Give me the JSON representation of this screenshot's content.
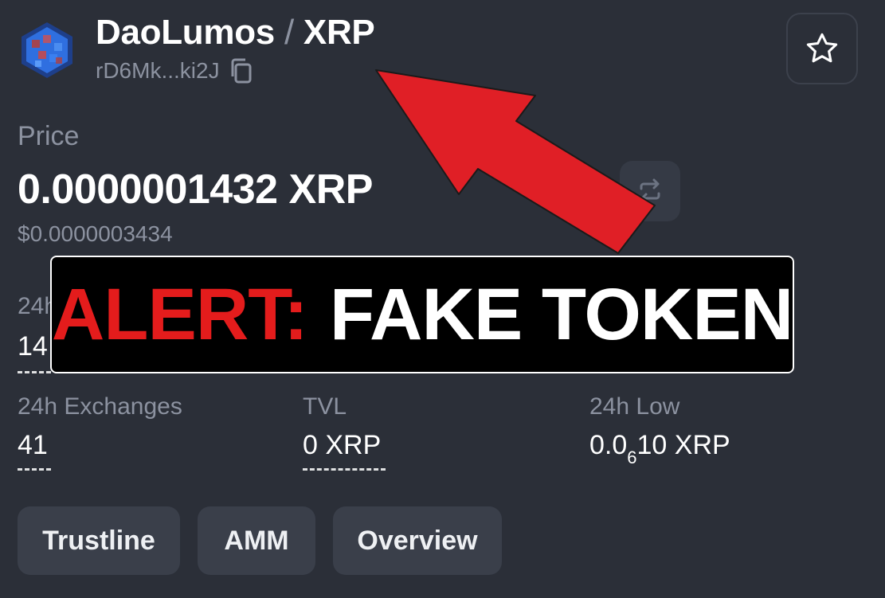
{
  "header": {
    "token_name": "DaoLumos",
    "separator": "/",
    "quote": "XRP",
    "address": "rD6Mk...ki2J",
    "icons": {
      "copy": "copy-icon",
      "favorite": "star-icon",
      "logo": "token-logo-icon"
    }
  },
  "price": {
    "label": "Price",
    "value": "0.0000001432 XRP",
    "usd": "$0.0000003434",
    "swap_icon": "swap-icon"
  },
  "stats_row1": {
    "label_partial": "24h",
    "value_partial": "14"
  },
  "stats": [
    {
      "label": "24h Exchanges",
      "value": "41"
    },
    {
      "label": "TVL",
      "value": "0 XRP"
    },
    {
      "label": "24h Low",
      "value_prefix": "0.0",
      "value_sub": "6",
      "value_suffix": "10 XRP"
    }
  ],
  "buttons": [
    {
      "label": "Trustline"
    },
    {
      "label": "AMM"
    },
    {
      "label": "Overview"
    }
  ],
  "alert": {
    "prefix": "ALERT:",
    "message": "FAKE TOKEN"
  },
  "colors": {
    "background": "#2b2f38",
    "muted_text": "#8c92a0",
    "button_bg": "#3a3f4a",
    "alert_red": "#e41c1c",
    "arrow_red": "#e01f26"
  }
}
